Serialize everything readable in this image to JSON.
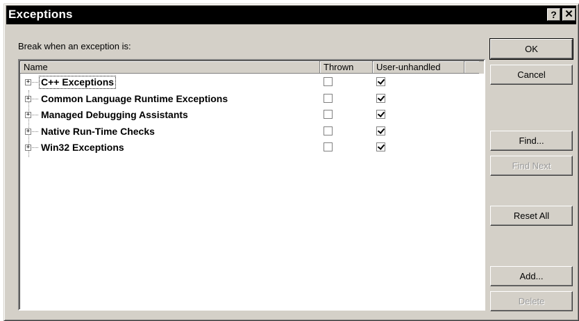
{
  "window": {
    "title": "Exceptions",
    "help_glyph": "?",
    "close_glyph": "✕"
  },
  "prompt_label": "Break when an exception is:",
  "columns": {
    "name": "Name",
    "thrown": "Thrown",
    "unhandled": "User-unhandled"
  },
  "rows": [
    {
      "label": "C++ Exceptions",
      "thrown": false,
      "user_unhandled": true,
      "focused": true
    },
    {
      "label": "Common Language Runtime Exceptions",
      "thrown": false,
      "user_unhandled": true,
      "focused": false
    },
    {
      "label": "Managed Debugging Assistants",
      "thrown": false,
      "user_unhandled": true,
      "focused": false
    },
    {
      "label": "Native Run-Time Checks",
      "thrown": false,
      "user_unhandled": true,
      "focused": false
    },
    {
      "label": "Win32 Exceptions",
      "thrown": false,
      "user_unhandled": true,
      "focused": false
    }
  ],
  "expander_glyph": "+",
  "buttons": {
    "ok": "OK",
    "cancel": "Cancel",
    "find": "Find...",
    "find_next": "Find Next",
    "reset_all": "Reset All",
    "add": "Add...",
    "delete": "Delete"
  },
  "button_state": {
    "find_next_enabled": false,
    "delete_enabled": false
  }
}
